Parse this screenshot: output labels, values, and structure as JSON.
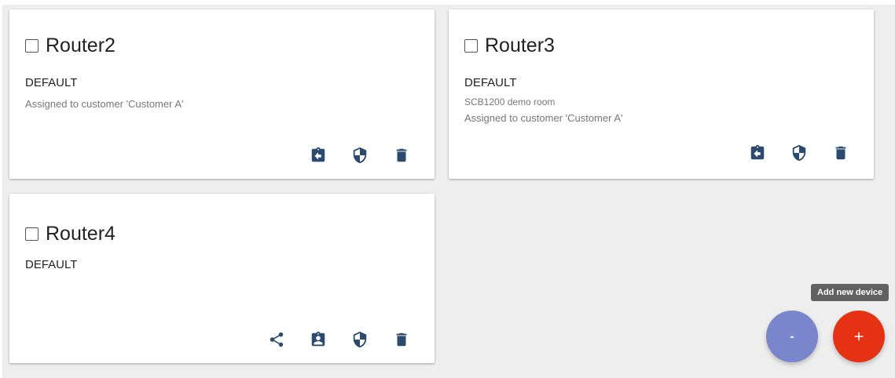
{
  "cards": [
    {
      "title": "Router2",
      "type": "DEFAULT",
      "assigned": "Assigned to customer 'Customer A'"
    },
    {
      "title": "Router3",
      "type": "DEFAULT",
      "label": "SCB1200 demo room",
      "assigned": "Assigned to customer 'Customer A'"
    },
    {
      "title": "Router4",
      "type": "DEFAULT"
    }
  ],
  "fab": {
    "tooltip": "Add new device"
  },
  "icons": {
    "unassign": "assignment-return-icon",
    "assign": "assignment-ind-icon",
    "credentials": "security-shield-icon",
    "delete": "delete-icon",
    "share": "share-icon",
    "collapse": "arrow-up-icon",
    "add": "plus-icon"
  },
  "colors": {
    "icon": "#2b4a6e",
    "fab_secondary": "#7986cb",
    "fab_primary": "#e53114",
    "background": "#eeeeee",
    "tooltip": "#616161"
  }
}
